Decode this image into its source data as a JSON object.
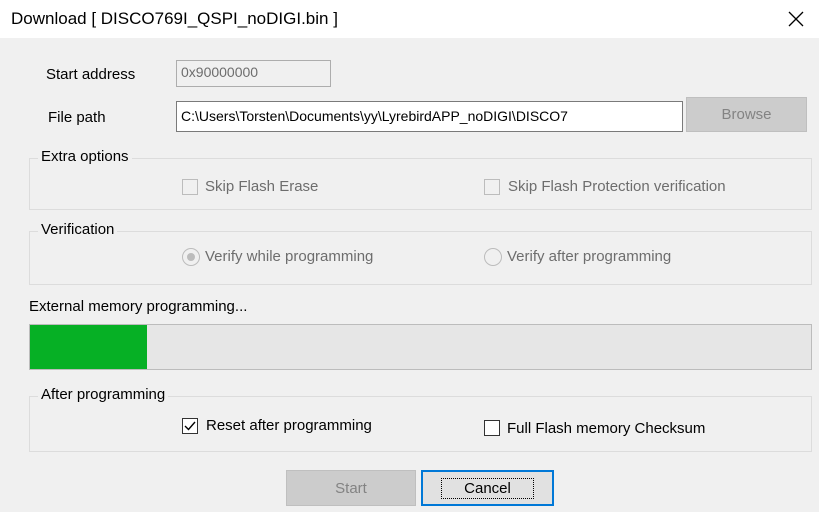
{
  "window": {
    "title": "Download [ DISCO769I_QSPI_noDIGI.bin ]"
  },
  "start_address": {
    "label": "Start address",
    "value": "0x90000000"
  },
  "file_path": {
    "label": "File path",
    "value": "C:\\Users\\Torsten\\Documents\\yy\\LyrebirdAPP_noDIGI\\DISCO7",
    "browse_label": "Browse"
  },
  "extra_options": {
    "title": "Extra options",
    "skip_flash_erase": {
      "label": "Skip Flash Erase",
      "checked": false
    },
    "skip_flash_protection": {
      "label": "Skip Flash Protection verification",
      "checked": false
    }
  },
  "verification": {
    "title": "Verification",
    "verify_while": {
      "label": "Verify while programming",
      "selected": true
    },
    "verify_after": {
      "label": "Verify after programming",
      "selected": false
    }
  },
  "progress": {
    "status_text": "External memory programming...",
    "fraction": 0.15,
    "color": "#06b025"
  },
  "after_programming": {
    "title": "After programming",
    "reset": {
      "label": "Reset after programming",
      "checked": true
    },
    "checksum": {
      "label": "Full Flash memory Checksum",
      "checked": false
    }
  },
  "actions": {
    "start_label": "Start",
    "cancel_label": "Cancel"
  }
}
